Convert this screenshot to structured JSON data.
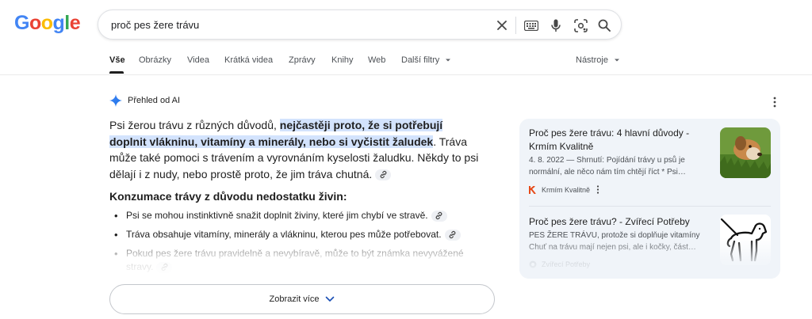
{
  "logo": {
    "text": "Google"
  },
  "search": {
    "query": "proč pes žere trávu"
  },
  "tabs": [
    {
      "label": "Vše",
      "active": true
    },
    {
      "label": "Obrázky"
    },
    {
      "label": "Videa"
    },
    {
      "label": "Krátká videa"
    },
    {
      "label": "Zprávy"
    },
    {
      "label": "Knihy"
    },
    {
      "label": "Web"
    },
    {
      "label": "Další filtry"
    }
  ],
  "tools": {
    "label": "Nástroje"
  },
  "ai_overview": {
    "title": "Přehled od AI",
    "intro_plain": "Psi žerou trávu z různých důvodů, ",
    "intro_highlight": "nejčastěji proto, že si potřebují doplnit vlákninu, vitamíny a minerály, nebo si vyčistit žaludek",
    "intro_rest": ". Tráva může také pomoci s trávením a vyrovnáním kyselosti žaludku. Někdy to psi dělají i z nudy, nebo prostě proto, že jim tráva chutná.",
    "section_title": "Konzumace trávy z důvodu nedostatku živin:",
    "bullets": [
      "Psi se mohou instinktivně snažit doplnit živiny, které jim chybí ve stravě.",
      "Tráva obsahuje vitamíny, minerály a vlákninu, kterou pes může potřebovat.",
      "Pokud pes žere trávu pravidelně a nevybíravě, může to být známka nevyvážené stravy."
    ],
    "show_more": "Zobrazit více"
  },
  "sources": [
    {
      "title": "Proč pes žere trávu: 4 hlavní důvody - Krmím Kvalitně",
      "snippet_line1": "4. 8. 2022 — Shrnutí: Pojídání trávy u psů je",
      "snippet_line2": "normální, ale něco nám tím chtějí říct * Psi…",
      "site": "Krmím Kvalitně"
    },
    {
      "title": "Proč pes žere trávu? - Zvířecí Potřeby",
      "snippet_line1": "PES ŽERE TRÁVU, protože si doplňuje vitamíny",
      "snippet_line2": "Chuť na trávu mají nejen psi, ale i kočky, část…",
      "site": "Zvířecí Potřeby"
    }
  ],
  "colors": {
    "google_blue": "#4285F4",
    "google_red": "#EA4335",
    "google_yellow": "#FBBC05",
    "google_green": "#34A853",
    "highlight": "#d3e3fd",
    "sources_bg": "#f0f4f9"
  }
}
